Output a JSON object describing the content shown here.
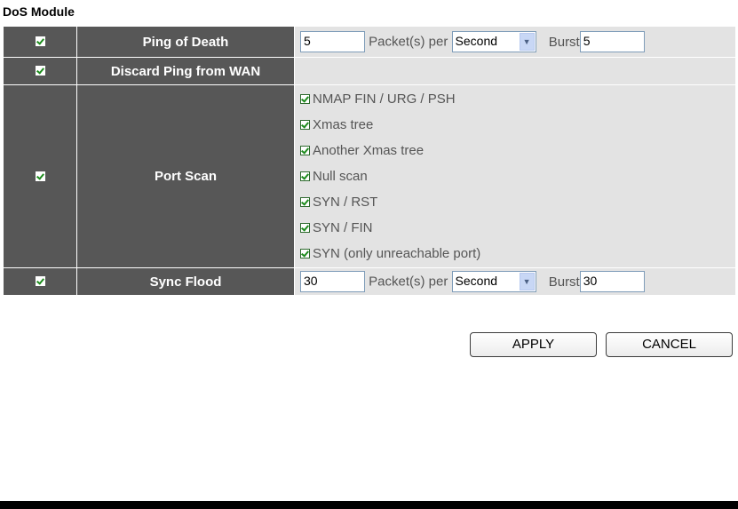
{
  "module_title": "DoS Module",
  "rows": {
    "ping_of_death": {
      "enabled": true,
      "label": "Ping of Death",
      "packets": "5",
      "packets_label": "Packet(s) per",
      "period": "Second",
      "burst_label": "Burst",
      "burst": "5"
    },
    "discard_ping": {
      "enabled": true,
      "label": "Discard Ping from WAN"
    },
    "port_scan": {
      "enabled": true,
      "label": "Port Scan",
      "options": [
        {
          "label": "NMAP FIN / URG / PSH",
          "checked": true
        },
        {
          "label": "Xmas tree",
          "checked": true
        },
        {
          "label": "Another Xmas tree",
          "checked": true
        },
        {
          "label": "Null scan",
          "checked": true
        },
        {
          "label": "SYN / RST",
          "checked": true
        },
        {
          "label": "SYN / FIN",
          "checked": true
        },
        {
          "label": "SYN (only unreachable port)",
          "checked": true
        }
      ]
    },
    "sync_flood": {
      "enabled": true,
      "label": "Sync Flood",
      "packets": "30",
      "packets_label": "Packet(s) per",
      "period": "Second",
      "burst_label": "Burst",
      "burst": "30"
    }
  },
  "buttons": {
    "apply": "APPLY",
    "cancel": "CANCEL"
  },
  "colors": {
    "label_bg": "#575757",
    "value_bg": "#e3e3e3",
    "check": "#1c8b1c"
  },
  "icons": {
    "checkbox": "checkbox-checked-icon",
    "dropdown": "chevron-down-icon"
  }
}
